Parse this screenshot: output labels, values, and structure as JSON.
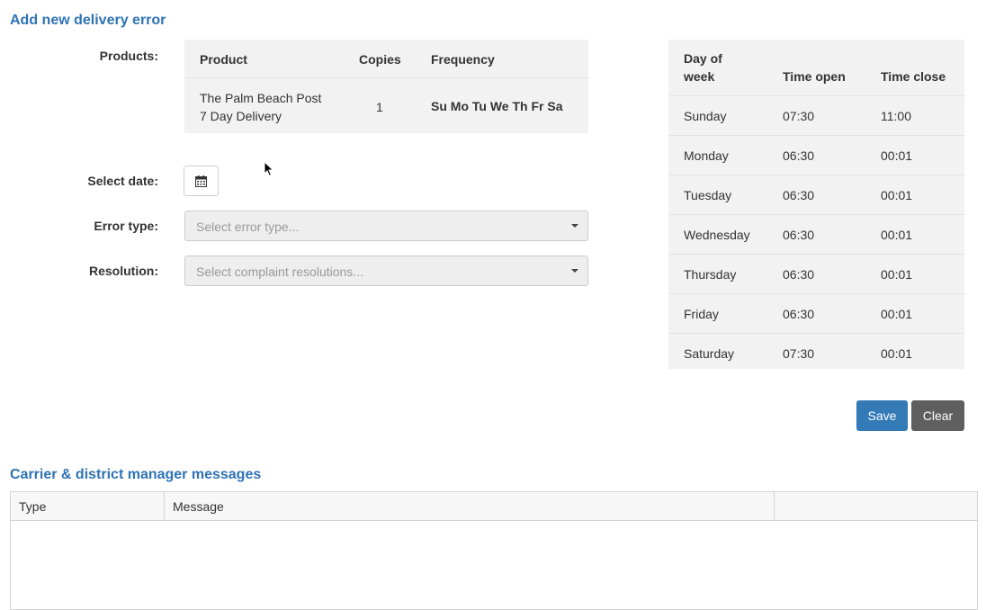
{
  "headings": {
    "main": "Add new delivery error",
    "messages": "Carrier & district manager messages"
  },
  "labels": {
    "products": "Products:",
    "select_date": "Select date:",
    "error_type": "Error type:",
    "resolution": "Resolution:"
  },
  "products": {
    "headers": [
      "Product",
      "Copies",
      "Frequency"
    ],
    "rows": [
      {
        "product_line1": "The Palm Beach Post",
        "product_line2": "7 Day Delivery",
        "copies": "1",
        "frequency": "Su Mo Tu We Th Fr Sa"
      }
    ]
  },
  "error_type": {
    "placeholder": "Select error type..."
  },
  "resolution": {
    "placeholder": "Select complaint resolutions..."
  },
  "hours": {
    "headers": {
      "day_line1": "Day of",
      "day_line2": "week",
      "open": "Time open",
      "close": "Time close"
    },
    "rows": [
      {
        "day": "Sunday",
        "open": "07:30",
        "close": "11:00"
      },
      {
        "day": "Monday",
        "open": "06:30",
        "close": "00:01"
      },
      {
        "day": "Tuesday",
        "open": "06:30",
        "close": "00:01"
      },
      {
        "day": "Wednesday",
        "open": "06:30",
        "close": "00:01"
      },
      {
        "day": "Thursday",
        "open": "06:30",
        "close": "00:01"
      },
      {
        "day": "Friday",
        "open": "06:30",
        "close": "00:01"
      },
      {
        "day": "Saturday",
        "open": "07:30",
        "close": "00:01"
      }
    ]
  },
  "buttons": {
    "save": "Save",
    "clear": "Clear"
  },
  "messages_grid": {
    "columns": [
      "Type",
      "Message",
      ""
    ]
  },
  "icons": {
    "date_picker": "calendar-icon",
    "dropdown": "caret-down-icon",
    "pointer": "mouse-cursor-icon"
  },
  "colors": {
    "heading": "#2f73b5",
    "save": "#337ab7",
    "clear": "#5f5f5f",
    "table_bg": "#f2f2f2"
  }
}
